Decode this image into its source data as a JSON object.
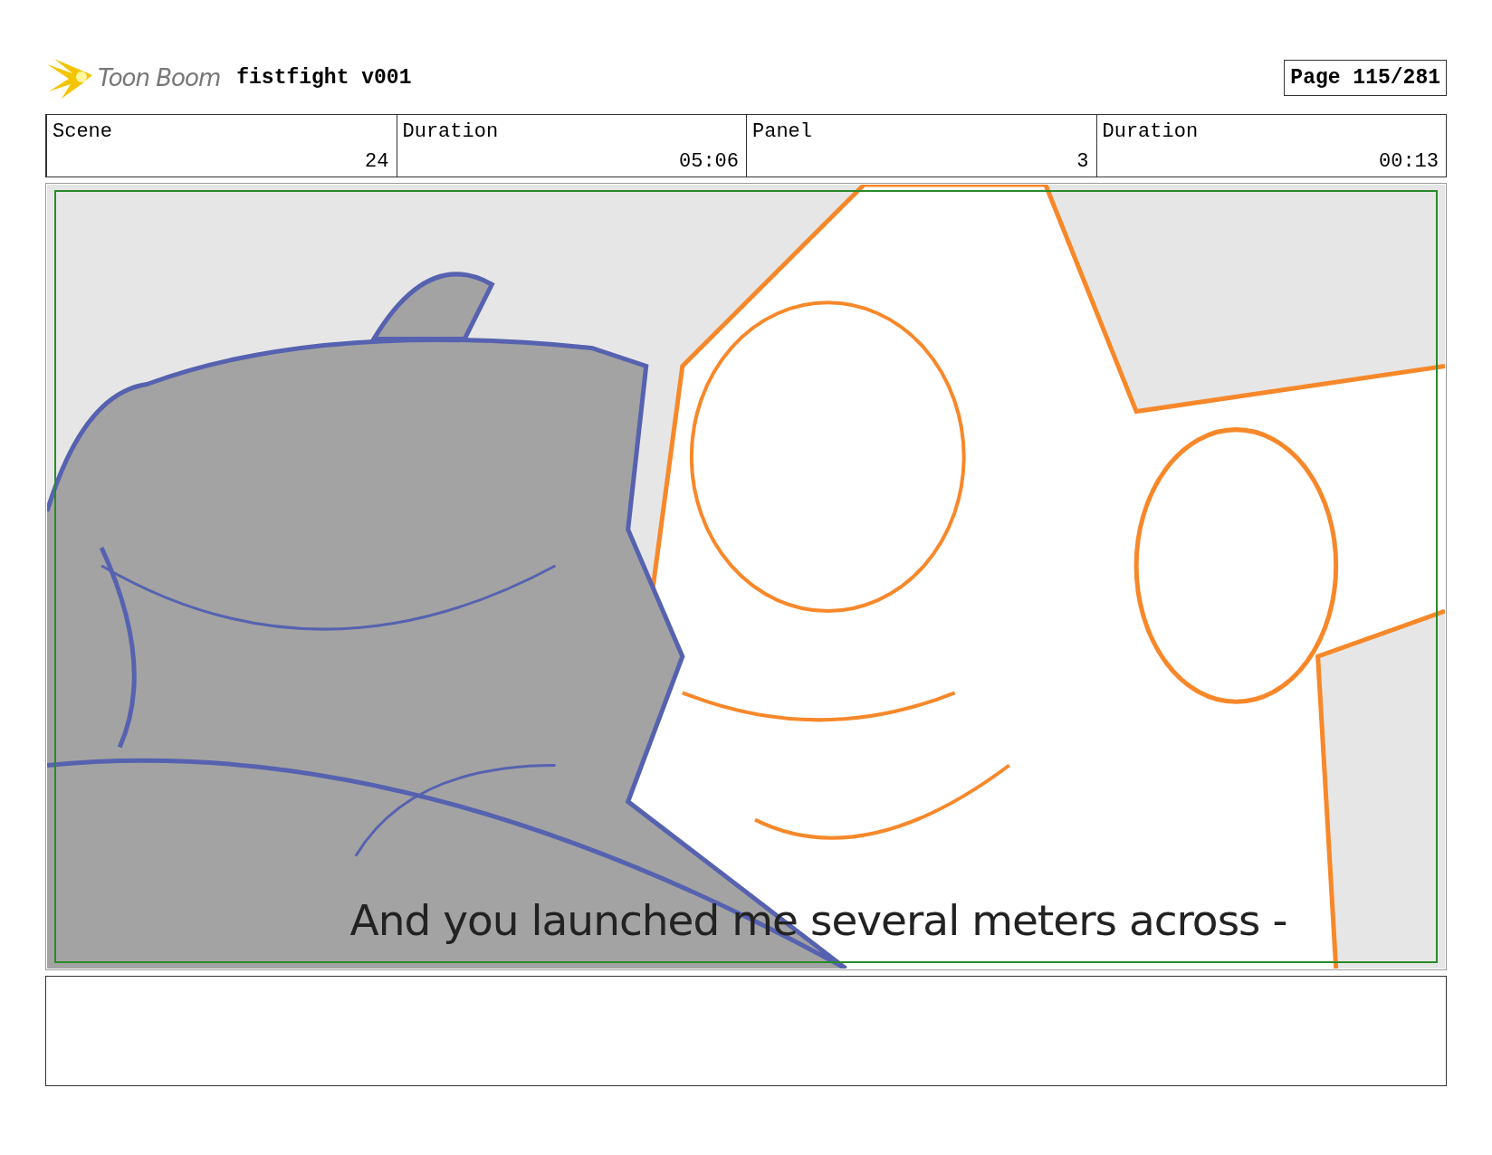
{
  "header": {
    "logo_text": "Toon Boom",
    "project_title": "fistfight v001",
    "page": "Page 115/281"
  },
  "info": [
    {
      "heading": "Scene",
      "figure": "24"
    },
    {
      "heading": "Duration",
      "figure": "05:06"
    },
    {
      "heading": "Panel",
      "figure": "3"
    },
    {
      "heading": "Duration",
      "figure": "00:13"
    }
  ],
  "panel": {
    "caption": "And you launched me several meters across -"
  }
}
